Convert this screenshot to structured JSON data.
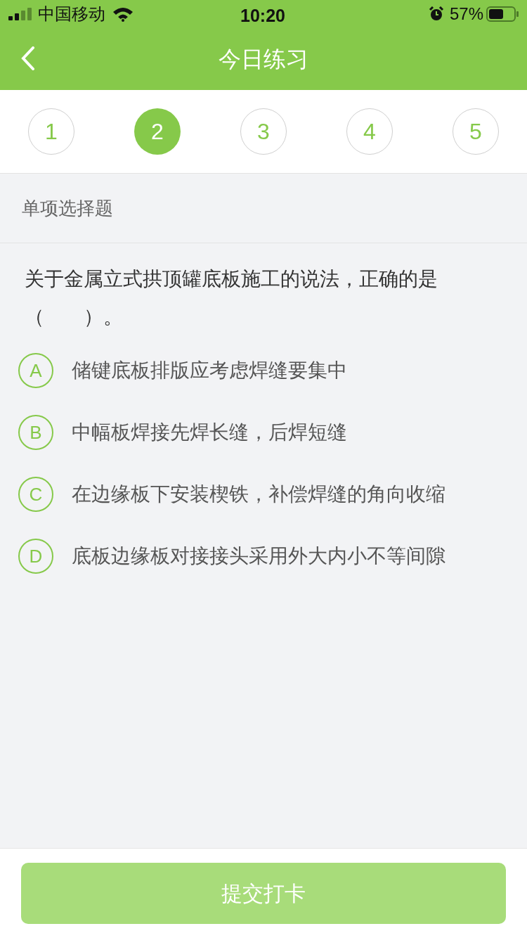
{
  "status_bar": {
    "carrier": "中国移动",
    "time": "10:20",
    "battery": "57%"
  },
  "nav": {
    "title": "今日练习"
  },
  "steps": [
    {
      "label": "1",
      "selected": false
    },
    {
      "label": "2",
      "selected": true
    },
    {
      "label": "3",
      "selected": false
    },
    {
      "label": "4",
      "selected": false
    },
    {
      "label": "5",
      "selected": false
    }
  ],
  "question_type": "单项选择题",
  "question": "关于金属立式拱顶罐底板施工的说法，正确的是（　　）。",
  "options": [
    {
      "letter": "A",
      "text": "储键底板排版应考虑焊缝要集中",
      "selected": false
    },
    {
      "letter": "B",
      "text": "中幅板焊接先焊长缝，后焊短缝",
      "selected": false
    },
    {
      "letter": "C",
      "text": "在边缘板下安装楔铁，补偿焊缝的角向收缩",
      "selected": false
    },
    {
      "letter": "D",
      "text": "底板边缘板对接接头采用外大内小不等间隙",
      "selected": false
    }
  ],
  "submit": {
    "label": "提交打卡",
    "disabled": true
  }
}
